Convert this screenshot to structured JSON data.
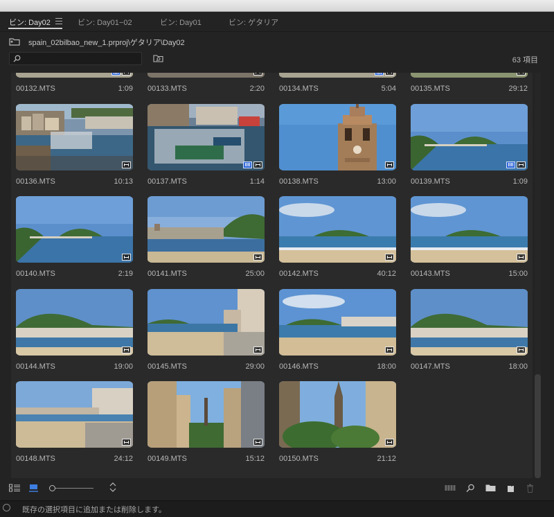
{
  "tabs": [
    {
      "label": "ビン: Day02",
      "active": true
    },
    {
      "label": "ビン: Day01−02",
      "active": false
    },
    {
      "label": "ビン: Day01",
      "active": false
    },
    {
      "label": "ビン: ゲタリア",
      "active": false
    }
  ],
  "path": "spain_02bilbao_new_1.prproj\\ゲタリア\\Day02",
  "search": {
    "value": "",
    "placeholder": ""
  },
  "item_count": "63 項目",
  "clips": [
    {
      "name": "00132.MTS",
      "duration": "1:09",
      "scene": "partial-a",
      "audio": true
    },
    {
      "name": "00133.MTS",
      "duration": "2:20",
      "scene": "partial-b",
      "audio": false
    },
    {
      "name": "00134.MTS",
      "duration": "5:04",
      "scene": "partial-a",
      "audio": true
    },
    {
      "name": "00135.MTS",
      "duration": "29:12",
      "scene": "partial-c",
      "audio": false
    },
    {
      "name": "00136.MTS",
      "duration": "10:13",
      "scene": "harbor",
      "audio": false
    },
    {
      "name": "00137.MTS",
      "duration": "1:14",
      "scene": "harbor2",
      "audio": true
    },
    {
      "name": "00138.MTS",
      "duration": "13:00",
      "scene": "tower",
      "audio": false
    },
    {
      "name": "00139.MTS",
      "duration": "1:09",
      "scene": "island",
      "audio": true
    },
    {
      "name": "00140.MTS",
      "duration": "2:19",
      "scene": "island",
      "audio": false
    },
    {
      "name": "00141.MTS",
      "duration": "25:00",
      "scene": "bay",
      "audio": false
    },
    {
      "name": "00142.MTS",
      "duration": "40:12",
      "scene": "beach",
      "audio": false
    },
    {
      "name": "00143.MTS",
      "duration": "15:00",
      "scene": "beach",
      "audio": false
    },
    {
      "name": "00144.MTS",
      "duration": "19:00",
      "scene": "hill",
      "audio": false
    },
    {
      "name": "00145.MTS",
      "duration": "29:00",
      "scene": "promenade",
      "audio": false
    },
    {
      "name": "00146.MTS",
      "duration": "18:00",
      "scene": "beach2",
      "audio": false
    },
    {
      "name": "00147.MTS",
      "duration": "18:00",
      "scene": "hill",
      "audio": false
    },
    {
      "name": "00148.MTS",
      "duration": "24:12",
      "scene": "promenade2",
      "audio": false
    },
    {
      "name": "00149.MTS",
      "duration": "15:12",
      "scene": "street",
      "audio": false
    },
    {
      "name": "00150.MTS",
      "duration": "21:12",
      "scene": "church",
      "audio": false
    }
  ],
  "status_text": "既存の選択項目に追加または削除します。",
  "colors": {
    "panel": "#232323",
    "grid": "#2a2a2a",
    "audio_badge": "#2f66d8",
    "accent": "#3d7ee0"
  },
  "zoom_level": 0.0
}
